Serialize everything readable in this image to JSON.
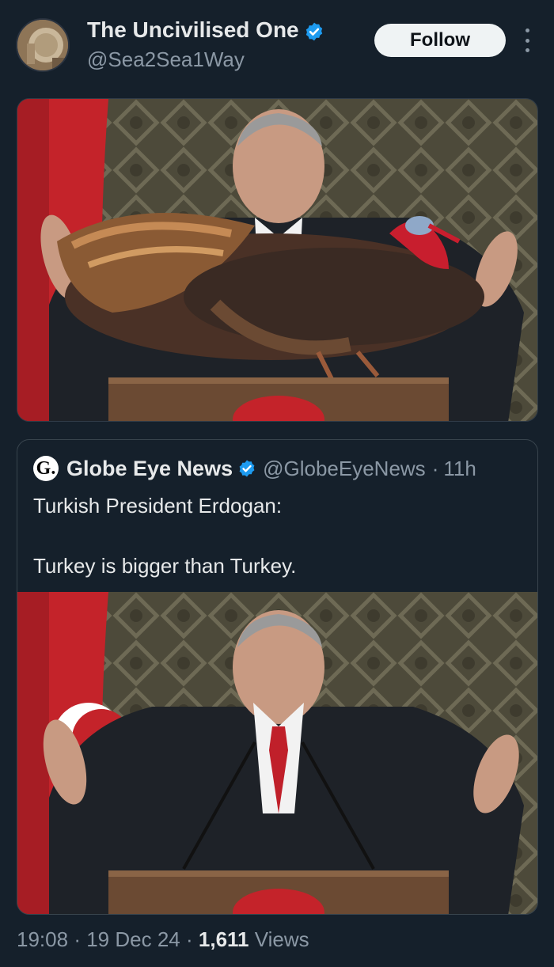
{
  "author": {
    "display_name": "The Uncivilised One",
    "handle": "@Sea2Sea1Way",
    "verified": true,
    "avatar_icon": "avatar-icon"
  },
  "actions": {
    "follow_label": "Follow",
    "more_icon": "more-options-icon"
  },
  "quoted": {
    "logo_letter": "G.",
    "name": "Globe Eye News",
    "handle": "@GlobeEyeNews",
    "separator": "·",
    "time": "11h",
    "text": "Turkish President Erdogan:\n\nTurkey is bigger than Turkey."
  },
  "meta": {
    "time": "19:08",
    "separator": "·",
    "date": "19 Dec 24",
    "separator2": "·",
    "views_count": "1,611",
    "views_label": "Views"
  },
  "colors": {
    "background": "#15202b",
    "verified_blue": "#1d9bf0",
    "text_primary": "#e7e9ea",
    "text_secondary": "#8b98a5"
  }
}
